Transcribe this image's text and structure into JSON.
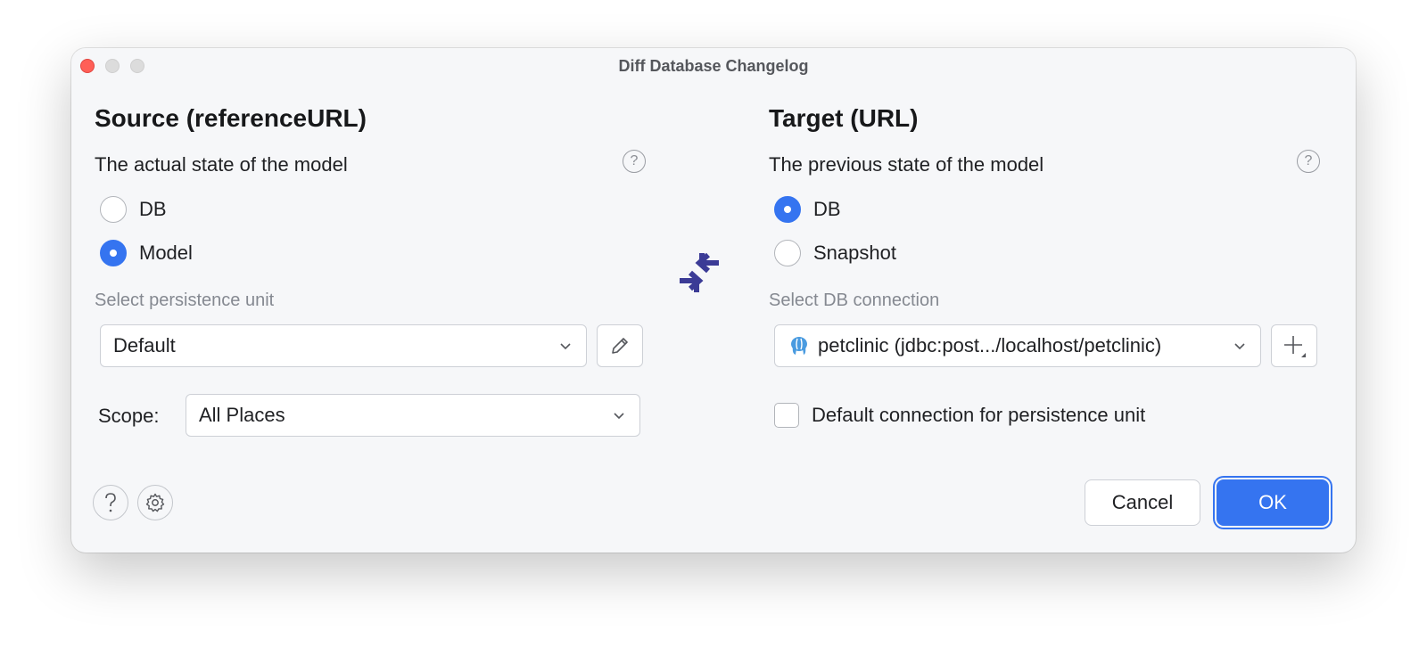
{
  "window": {
    "title": "Diff Database Changelog"
  },
  "source": {
    "heading": "Source (referenceURL)",
    "subtitle": "The actual state of the model",
    "options": [
      {
        "label": "DB",
        "checked": false
      },
      {
        "label": "Model",
        "checked": true
      }
    ],
    "persistence_label": "Select persistence unit",
    "persistence_value": "Default",
    "scope_label": "Scope:",
    "scope_value": "All Places"
  },
  "target": {
    "heading": "Target (URL)",
    "subtitle": "The previous state of the model",
    "options": [
      {
        "label": "DB",
        "checked": true
      },
      {
        "label": "Snapshot",
        "checked": false
      }
    ],
    "connection_label": "Select DB connection",
    "connection_value": "petclinic (jdbc:post.../localhost/petclinic)",
    "default_connection_label": "Default connection for persistence unit",
    "default_connection_checked": false
  },
  "footer": {
    "cancel_label": "Cancel",
    "ok_label": "OK"
  },
  "icons": {
    "help": "question-mark-icon",
    "edit": "pencil-icon",
    "add": "plus-icon",
    "db": "postgresql-elephant-icon",
    "swap": "compare-arrows-icon",
    "settings": "gear-icon"
  },
  "colors": {
    "accent": "#3574f0",
    "swap_icon": "#3b3b96",
    "close": "#ff5f57"
  }
}
